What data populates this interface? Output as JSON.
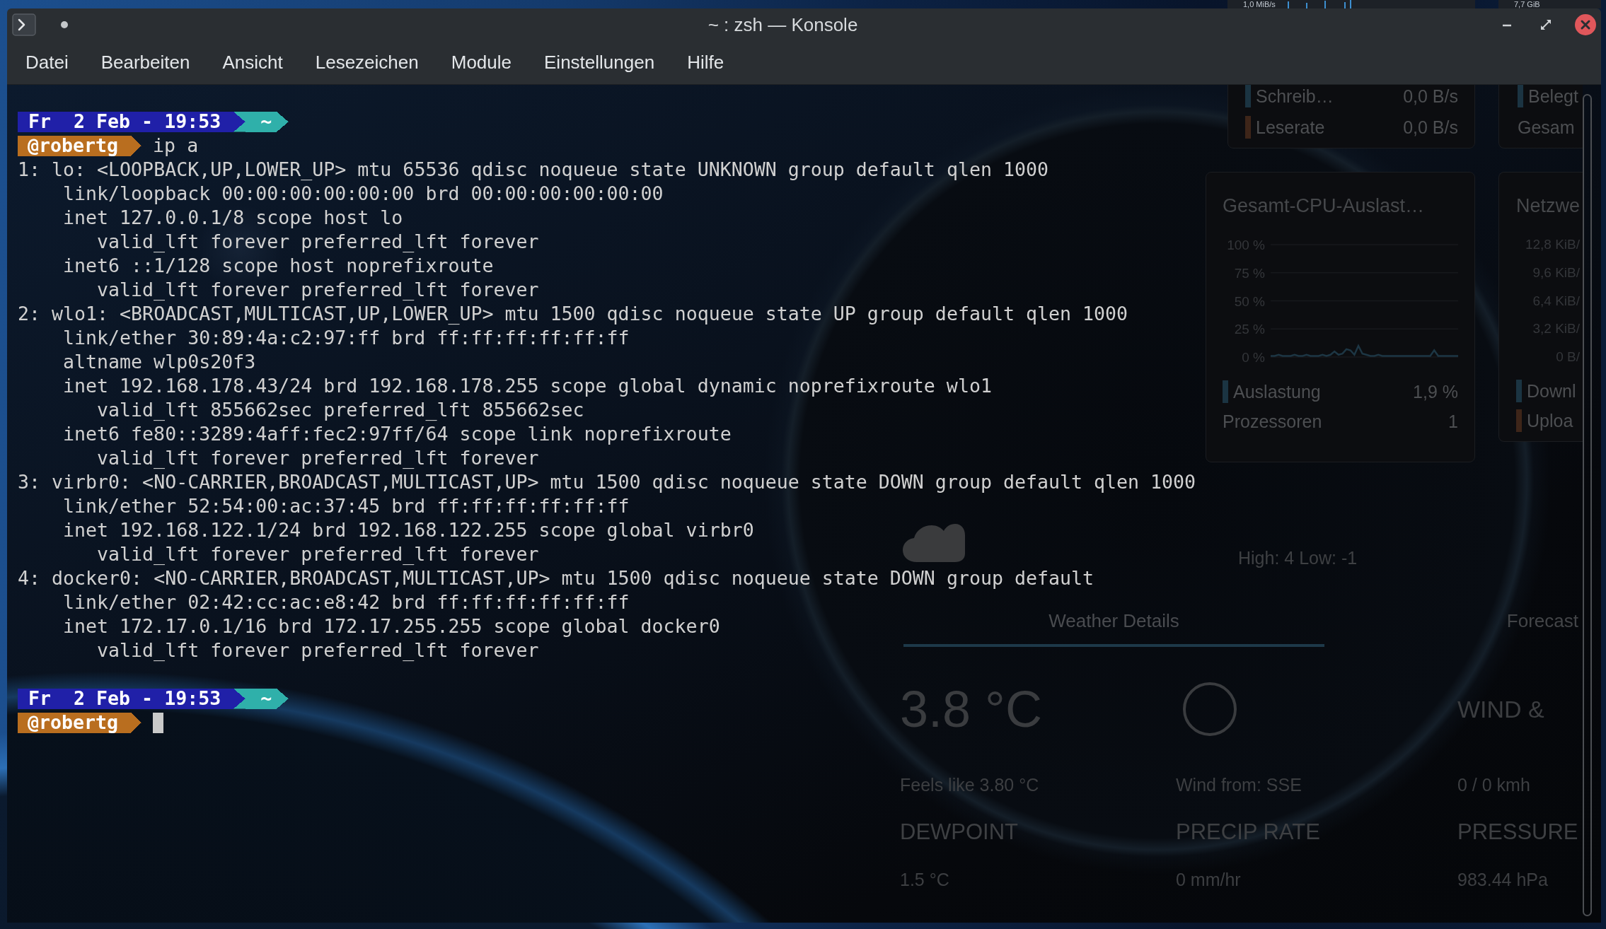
{
  "desktop": {
    "peek": [
      "1,0 MiB/s",
      "7,7 GiB"
    ]
  },
  "window": {
    "title": "~ : zsh — Konsole"
  },
  "menu": [
    "Datei",
    "Bearbeiten",
    "Ansicht",
    "Lesezeichen",
    "Module",
    "Einstellungen",
    "Hilfe"
  ],
  "terminal": {
    "lines": [
      {
        "kind": "prompt",
        "date": "Fr  2 Feb - 19:53",
        "directory": "~",
        "user": "@robertg",
        "command": "ip a",
        "cursor": false
      },
      {
        "kind": "output",
        "text": "1: lo: <LOOPBACK,UP,LOWER_UP> mtu 65536 qdisc noqueue state UNKNOWN group default qlen 1000",
        "children": [
          {
            "text": "link/loopback 00:00:00:00:00:00 brd 00:00:00:00:00:00"
          },
          {
            "text": "inet 127.0.0.1/8 scope host lo",
            "children": [
              {
                "text": "valid_lft forever preferred_lft forever"
              }
            ]
          },
          {
            "text": "inet6 ::1/128 scope host noprefixroute",
            "children": [
              {
                "text": "valid_lft forever preferred_lft forever"
              }
            ]
          }
        ]
      },
      {
        "kind": "output",
        "text": "2: wlo1: <BROADCAST,MULTICAST,UP,LOWER_UP> mtu 1500 qdisc noqueue state UP group default qlen 1000",
        "children": [
          {
            "text": "link/ether 30:89:4a:c2:97:ff brd ff:ff:ff:ff:ff:ff"
          },
          {
            "text": "altname wlp0s20f3"
          },
          {
            "text": "inet 192.168.178.43/24 brd 192.168.178.255 scope global dynamic noprefixroute wlo1",
            "children": [
              {
                "text": "valid_lft 855662sec preferred_lft 855662sec"
              }
            ]
          },
          {
            "text": "inet6 fe80::3289:4aff:fec2:97ff/64 scope link noprefixroute",
            "children": [
              {
                "text": "valid_lft forever preferred_lft forever"
              }
            ]
          }
        ]
      },
      {
        "kind": "output",
        "text": "3: virbr0: <NO-CARRIER,BROADCAST,MULTICAST,UP> mtu 1500 qdisc noqueue state DOWN group default qlen 1000",
        "children": [
          {
            "text": "link/ether 52:54:00:ac:37:45 brd ff:ff:ff:ff:ff:ff"
          },
          {
            "text": "inet 192.168.122.1/24 brd 192.168.122.255 scope global virbr0",
            "children": [
              {
                "text": "valid_lft forever preferred_lft forever"
              }
            ]
          }
        ]
      },
      {
        "kind": "output",
        "text": "4: docker0: <NO-CARRIER,BROADCAST,MULTICAST,UP> mtu 1500 qdisc noqueue state DOWN group default",
        "children": [
          {
            "text": "link/ether 02:42:cc:ac:e8:42 brd ff:ff:ff:ff:ff:ff"
          },
          {
            "text": "inet 172.17.0.1/16 brd 172.17.255.255 scope global docker0",
            "children": [
              {
                "text": "valid_lft forever preferred_lft forever"
              }
            ]
          }
        ]
      },
      {
        "kind": "blank"
      },
      {
        "kind": "prompt",
        "date": "Fr  2 Feb - 19:53",
        "directory": "~",
        "user": "@robertg",
        "cursor": true
      }
    ]
  },
  "widgets": {
    "disk": {
      "rows": [
        {
          "label": "Schreib…",
          "value": "0,0 B/s",
          "color": "#1b3442"
        },
        {
          "label": "Leserate",
          "value": "0,0 B/s",
          "color": "#3e2519"
        }
      ]
    },
    "memory": {
      "rows": [
        {
          "label": "Belegt",
          "color": "#1b3442"
        },
        {
          "label": "Gesam"
        }
      ]
    },
    "cpu": {
      "title": "Gesamt-CPU-Auslast…",
      "chart_data": {
        "type": "line",
        "grid": true,
        "ylim": [
          0,
          100
        ],
        "yticks": [
          {
            "value": 100,
            "label": "100 %"
          },
          {
            "value": 75,
            "label": "75 %"
          },
          {
            "value": 50,
            "label": "50 %"
          },
          {
            "value": 25,
            "label": "25 %"
          },
          {
            "value": 0,
            "label": "0 %"
          }
        ],
        "series": [
          {
            "color": "#1d3644",
            "values": [
              1,
              1,
              2,
              1,
              1,
              1,
              2,
              1,
              1,
              2,
              1,
              1,
              1,
              2,
              1,
              2,
              5,
              2,
              3,
              7,
              6,
              2,
              10,
              3,
              2,
              1,
              1,
              2,
              1,
              1,
              1,
              1,
              1,
              1,
              1,
              1,
              1,
              1,
              1,
              1,
              1,
              6,
              1,
              1,
              1,
              1,
              1,
              1
            ]
          }
        ]
      },
      "rows": [
        {
          "label": "Auslastung",
          "value": "1,9 %",
          "color": "#1b3442"
        },
        {
          "label": "Prozessoren",
          "value": "1"
        }
      ]
    },
    "network": {
      "title": "Netzwe",
      "axis_labels": [
        "12,8 KiB/",
        "9,6 KiB/",
        "6,4 KiB/",
        "3,2 KiB/",
        "0 B/"
      ],
      "rows": [
        {
          "label": "Downl",
          "color": "#1b3442"
        },
        {
          "label": "Uploa",
          "color": "#3e2519"
        }
      ]
    },
    "weather": {
      "high_low": "High: 4 Low: -1",
      "tabs": [
        {
          "label": "Weather Details",
          "selected": true
        },
        {
          "label": "Forecast",
          "selected": false
        }
      ],
      "temperature": "3.8 °C",
      "wind_heading": "WIND &",
      "feels_like": "Feels like 3.80 °C",
      "wind_from": "Wind from: SSE",
      "wind_speed": "0 / 0 kmh",
      "details": [
        {
          "label": "DEWPOINT",
          "value": "1.5 °C"
        },
        {
          "label": "PRECIP RATE",
          "value": "0 mm/hr"
        },
        {
          "label": "PRESSURE",
          "value": "983.44 hPa"
        }
      ]
    }
  }
}
